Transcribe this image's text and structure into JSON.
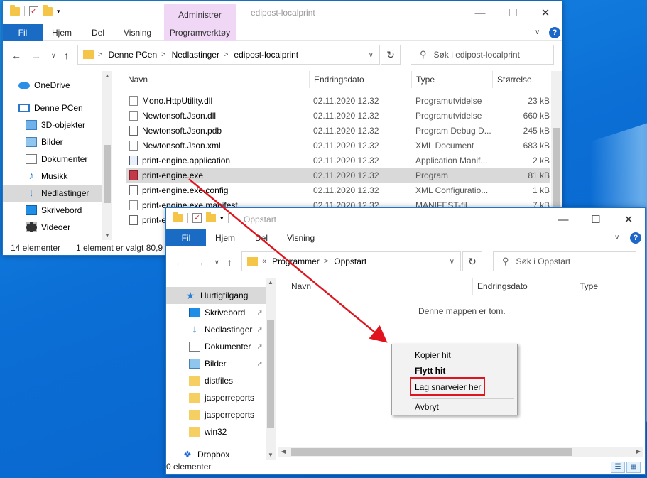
{
  "win1": {
    "title": "edipost-localprint",
    "context_tab_group": "Administrer",
    "tabs": [
      "Fil",
      "Hjem",
      "Del",
      "Visning"
    ],
    "context_tab": "Programverktøy",
    "path": [
      "Denne PCen",
      "Nedlastinger",
      "edipost-localprint"
    ],
    "search_placeholder": "Søk i edipost-localprint",
    "nav": [
      "OneDrive",
      "Denne PCen",
      "3D-objekter",
      "Bilder",
      "Dokumenter",
      "Musikk",
      "Nedlastinger",
      "Skrivebord",
      "Videoer"
    ],
    "columns": [
      "Navn",
      "Endringsdato",
      "Type",
      "Størrelse"
    ],
    "files": [
      {
        "name": "Mono.HttpUtility.dll",
        "date": "02.11.2020 12.32",
        "type": "Programutvidelse",
        "size": "23 kB"
      },
      {
        "name": "Newtonsoft.Json.dll",
        "date": "02.11.2020 12.32",
        "type": "Programutvidelse",
        "size": "660 kB"
      },
      {
        "name": "Newtonsoft.Json.pdb",
        "date": "02.11.2020 12.32",
        "type": "Program Debug D...",
        "size": "245 kB"
      },
      {
        "name": "Newtonsoft.Json.xml",
        "date": "02.11.2020 12.32",
        "type": "XML Document",
        "size": "683 kB"
      },
      {
        "name": "print-engine.application",
        "date": "02.11.2020 12.32",
        "type": "Application Manif...",
        "size": "2 kB"
      },
      {
        "name": "print-engine.exe",
        "date": "02.11.2020 12.32",
        "type": "Program",
        "size": "81 kB"
      },
      {
        "name": "print-engine.exe.config",
        "date": "02.11.2020 12.32",
        "type": "XML Configuratio...",
        "size": "1 kB"
      },
      {
        "name": "print-engine.exe.manifest",
        "date": "02.11.2020 12.32",
        "type": "MANIFEST-fil",
        "size": "7 kB"
      },
      {
        "name": "print-e",
        "date": "",
        "type": "",
        "size": ""
      }
    ],
    "status_count": "14 elementer",
    "status_selected": "1 element er valgt  80,9 k"
  },
  "win2": {
    "title": "Oppstart",
    "tabs": [
      "Fil",
      "Hjem",
      "Del",
      "Visning"
    ],
    "path_prefix": "«",
    "path": [
      "Programmer",
      "Oppstart"
    ],
    "search_placeholder": "Søk i Oppstart",
    "quick_access": "Hurtigtilgang",
    "nav": [
      "Skrivebord",
      "Nedlastinger",
      "Dokumenter",
      "Bilder",
      "distfiles",
      "jasperreports",
      "jasperreports",
      "win32",
      "Dropbox"
    ],
    "columns": [
      "Navn",
      "Endringsdato",
      "Type"
    ],
    "empty_text": "Denne mappen er tom.",
    "status_count": "0 elementer"
  },
  "context_menu": {
    "items": [
      "Kopier hit",
      "Flytt hit",
      "Lag snarveier her",
      "Avbryt"
    ]
  },
  "colors": {
    "accent": "#1a6bc4",
    "highlight_box": "#e0141e",
    "arrow": "#e0141e"
  }
}
